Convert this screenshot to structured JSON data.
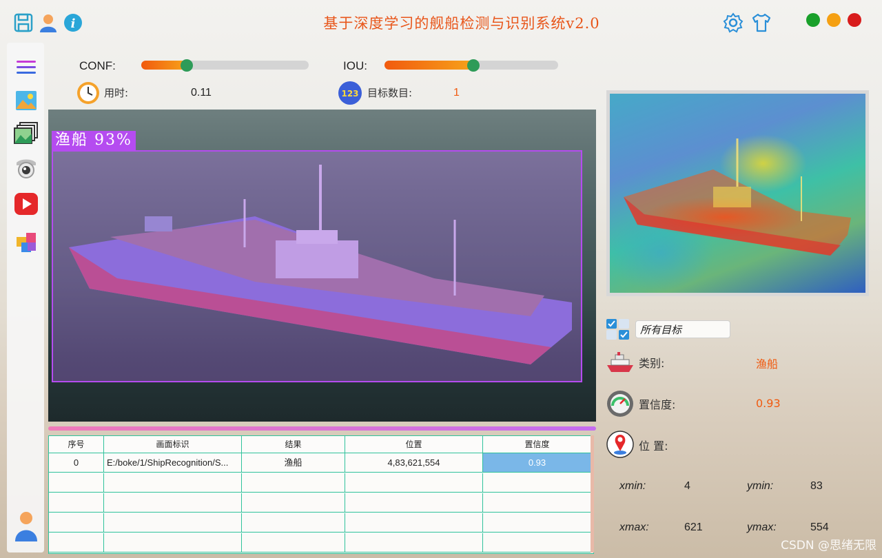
{
  "window": {
    "title": "基于深度学习的舰船检测与识别系统v2.0",
    "colors": {
      "green": "#19a02a",
      "orange": "#f5a012",
      "red": "#d81c1c",
      "accent": "#e8561a"
    }
  },
  "toolbar": {
    "icons": [
      "save-icon",
      "user-icon",
      "info-icon",
      "settings-icon",
      "theme-shirt-icon"
    ]
  },
  "sidebar": {
    "items": [
      "menu-icon",
      "image-icon",
      "folder-images-icon",
      "camera-icon",
      "video-icon",
      "model-cube-icon"
    ],
    "bottom": "user-avatar-icon"
  },
  "controls": {
    "conf_label": "CONF:",
    "conf_value": 0.27,
    "iou_label": "IOU:",
    "iou_value": 0.51,
    "time_label": "用时:",
    "time_value": "0.11",
    "count_label": "目标数目:",
    "count_value": "1"
  },
  "detection": {
    "label": "渔船 93%"
  },
  "table": {
    "headers": [
      "序号",
      "画面标识",
      "结果",
      "位置",
      "置信度"
    ],
    "rows": [
      [
        "0",
        "E:/boke/1/ShipRecognition/S...",
        "渔船",
        "4,83,621,554",
        "0.93"
      ]
    ],
    "empty_rows": 4
  },
  "details": {
    "select_value": "所有目标",
    "class_label": "类别:",
    "class_value": "渔船",
    "conf_label": "置信度:",
    "conf_value": "0.93",
    "pos_label": "位 置:",
    "xmin_label": "xmin:",
    "xmin": "4",
    "ymin_label": "ymin:",
    "ymin": "83",
    "xmax_label": "xmax:",
    "xmax": "621",
    "ymax_label": "ymax:",
    "ymax": "554"
  },
  "watermark": "CSDN @思绪无限"
}
